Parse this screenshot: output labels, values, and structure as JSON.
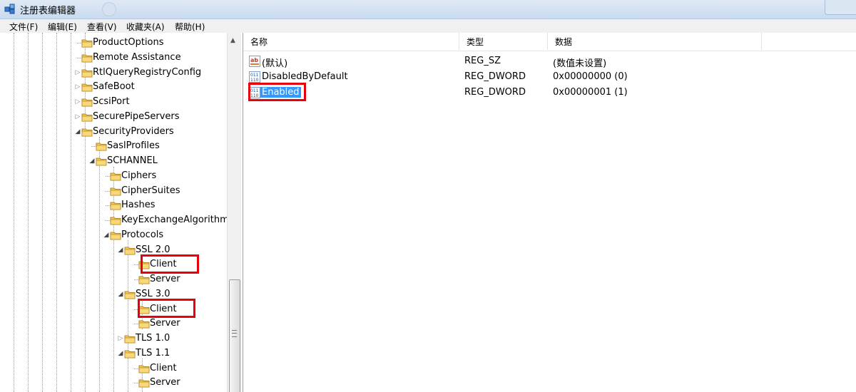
{
  "window": {
    "title": "注册表编辑器"
  },
  "menu": [
    "文件(F)",
    "编辑(E)",
    "查看(V)",
    "收藏夹(A)",
    "帮助(H)"
  ],
  "tree": {
    "items": [
      {
        "label": "ProductOptions",
        "expander": "none"
      },
      {
        "label": "Remote Assistance",
        "expander": "none"
      },
      {
        "label": "RtlQueryRegistryConfig",
        "expander": "collapsed"
      },
      {
        "label": "SafeBoot",
        "expander": "collapsed"
      },
      {
        "label": "ScsiPort",
        "expander": "collapsed"
      },
      {
        "label": "SecurePipeServers",
        "expander": "collapsed"
      },
      {
        "label": "SecurityProviders",
        "expander": "expanded"
      },
      {
        "label": "SaslProfiles",
        "expander": "none"
      },
      {
        "label": "SCHANNEL",
        "expander": "expanded"
      },
      {
        "label": "Ciphers",
        "expander": "none"
      },
      {
        "label": "CipherSuites",
        "expander": "none"
      },
      {
        "label": "Hashes",
        "expander": "none"
      },
      {
        "label": "KeyExchangeAlgorithm",
        "expander": "none"
      },
      {
        "label": "Protocols",
        "expander": "expanded"
      },
      {
        "label": "SSL 2.0",
        "expander": "expanded"
      },
      {
        "label": "Client",
        "expander": "none",
        "highlighted": true
      },
      {
        "label": "Server",
        "expander": "none"
      },
      {
        "label": "SSL 3.0",
        "expander": "expanded"
      },
      {
        "label": "Client",
        "expander": "none",
        "highlighted": true
      },
      {
        "label": "Server",
        "expander": "none"
      },
      {
        "label": "TLS 1.0",
        "expander": "collapsed"
      },
      {
        "label": "TLS 1.1",
        "expander": "expanded"
      },
      {
        "label": "Client",
        "expander": "none"
      },
      {
        "label": "Server",
        "expander": "none"
      }
    ]
  },
  "list": {
    "headers": {
      "name": "名称",
      "type": "类型",
      "data": "数据"
    },
    "rows": [
      {
        "icon": "string-value-icon",
        "name": "(默认)",
        "type": "REG_SZ",
        "data": "(数值未设置)"
      },
      {
        "icon": "dword-value-icon",
        "name": "DisabledByDefault",
        "type": "REG_DWORD",
        "data": "0x00000000 (0)"
      },
      {
        "icon": "dword-value-icon",
        "name": "Enabled",
        "type": "REG_DWORD",
        "data": "0x00000001 (1)",
        "selected": true,
        "highlighted": true
      }
    ]
  },
  "colors": {
    "selection": "#3399ff",
    "highlight_box": "#e8000b",
    "folder": "#f2c94c"
  }
}
